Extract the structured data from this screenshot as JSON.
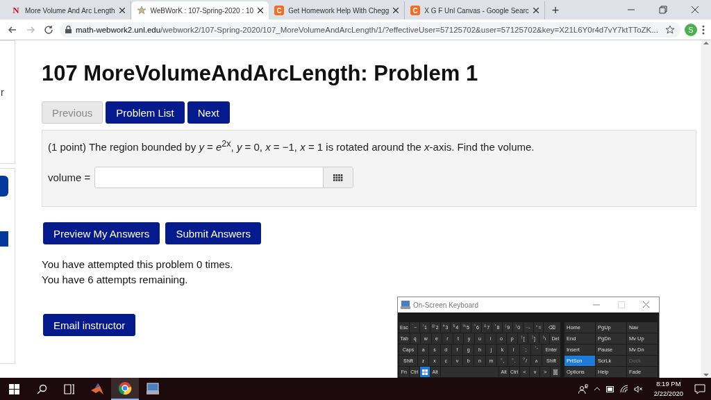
{
  "browser": {
    "tabs": [
      {
        "title": "More Volume And Arc Length",
        "icon_text": "N",
        "kind": "red-letter",
        "selected": false
      },
      {
        "title": "WeBWorK : 107-Spring-2020 : 10",
        "kind": "star",
        "selected": true
      },
      {
        "title": "Get Homework Help With Chegg",
        "icon_text": "C",
        "kind": "orange-letter",
        "selected": false
      },
      {
        "title": "X G F Unl Canvas - Google Searc",
        "icon_text": "C",
        "kind": "orange-letter",
        "selected": false
      }
    ],
    "new_tab": "+",
    "url_host": "math-webwork2.unl.edu",
    "url_path": "/webwork2/107-Spring-2020/107_MoreVolumeAndArcLength/1/?effectiveUser=57125702&user=57125702&key=X21L6Y0r4d7vY7ktTToZK...",
    "profile": "S"
  },
  "sidebar": {
    "text": "r"
  },
  "page": {
    "title": "107 MoreVolumeAndArcLength: Problem 1",
    "nav": [
      {
        "label": "Previous",
        "disabled": true
      },
      {
        "label": "Problem List",
        "disabled": false
      },
      {
        "label": "Next",
        "disabled": false
      }
    ],
    "problem": {
      "text": "(1 point) The region bounded by *y* = *e*$^{2x}$, *y* = 0, *x* = −1, *x* = 1 is rotated around the *x*-axis. Find the volume.",
      "answer_label": "volume ="
    },
    "actions": [
      "Preview My Answers",
      "Submit Answers"
    ],
    "messages": [
      "You have attempted this problem 0 times.",
      "You have 6 attempts remaining."
    ],
    "email": "Email instructor"
  },
  "osk": {
    "title": "On-Screen Keyboard",
    "rows": [
      [
        {
          "label": "Esc",
          "kind": "key"
        },
        {
          "label": "~",
          "top": "`",
          "kind": "key"
        },
        {
          "label": "1",
          "top": "!",
          "kind": "key"
        },
        {
          "label": "2",
          "top": "@",
          "kind": "key"
        },
        {
          "label": "3",
          "top": "#",
          "kind": "key"
        },
        {
          "label": "4",
          "top": "$",
          "kind": "key"
        },
        {
          "label": "5",
          "top": "%",
          "kind": "key"
        },
        {
          "label": "6",
          "top": "^",
          "kind": "key"
        },
        {
          "label": "7",
          "top": "&",
          "kind": "key"
        },
        {
          "label": "8",
          "top": "*",
          "kind": "key"
        },
        {
          "label": "9",
          "top": "(",
          "kind": "key"
        },
        {
          "label": "0",
          "top": ")",
          "kind": "key"
        },
        {
          "label": "-",
          "top": "_",
          "kind": "key"
        },
        {
          "label": "=",
          "top": "+",
          "kind": "key"
        },
        {
          "label": "⌫",
          "kind": "wide"
        }
      ],
      [
        {
          "label": "Tab",
          "kind": "key"
        },
        {
          "label": "q",
          "kind": "key"
        },
        {
          "label": "w",
          "kind": "key"
        },
        {
          "label": "e",
          "kind": "key"
        },
        {
          "label": "r",
          "kind": "key"
        },
        {
          "label": "t",
          "kind": "key"
        },
        {
          "label": "y",
          "kind": "key"
        },
        {
          "label": "u",
          "kind": "key"
        },
        {
          "label": "i",
          "kind": "key"
        },
        {
          "label": "o",
          "kind": "key"
        },
        {
          "label": "p",
          "kind": "key"
        },
        {
          "label": "[",
          "top": "{",
          "kind": "key"
        },
        {
          "label": "]",
          "top": "}",
          "kind": "key"
        },
        {
          "label": "\\",
          "top": "|",
          "kind": "key"
        },
        {
          "label": "Del",
          "kind": "key"
        }
      ],
      [
        {
          "label": "Caps",
          "kind": "wide"
        },
        {
          "label": "a",
          "kind": "key"
        },
        {
          "label": "s",
          "kind": "key"
        },
        {
          "label": "d",
          "kind": "key"
        },
        {
          "label": "f",
          "kind": "key"
        },
        {
          "label": "g",
          "kind": "key"
        },
        {
          "label": "h",
          "kind": "key"
        },
        {
          "label": "j",
          "kind": "key"
        },
        {
          "label": "k",
          "kind": "key"
        },
        {
          "label": "l",
          "kind": "key"
        },
        {
          "label": ";",
          "top": ":",
          "kind": "key"
        },
        {
          "label": "'",
          "top": "\"",
          "kind": "key"
        },
        {
          "label": "Enter",
          "kind": "wide"
        }
      ],
      [
        {
          "label": "Shift",
          "kind": "wide"
        },
        {
          "label": "z",
          "kind": "key"
        },
        {
          "label": "x",
          "kind": "key"
        },
        {
          "label": "c",
          "kind": "key"
        },
        {
          "label": "v",
          "kind": "key"
        },
        {
          "label": "b",
          "kind": "key"
        },
        {
          "label": "n",
          "kind": "key"
        },
        {
          "label": "m",
          "kind": "key"
        },
        {
          "label": ",",
          "top": "<",
          "kind": "key"
        },
        {
          "label": ".",
          "top": ">",
          "kind": "key"
        },
        {
          "label": "/",
          "top": "?",
          "kind": "key"
        },
        {
          "label": "∧",
          "kind": "key"
        },
        {
          "label": "Shift",
          "kind": "wide"
        }
      ],
      [
        {
          "label": "Fn",
          "kind": "key"
        },
        {
          "label": "Ctrl",
          "kind": "key"
        },
        {
          "kind": "windows"
        },
        {
          "label": "Alt",
          "kind": "key"
        },
        {
          "kind": "space"
        },
        {
          "label": "Alt",
          "kind": "key"
        },
        {
          "label": "Ctrl",
          "kind": "key"
        },
        {
          "label": "<",
          "kind": "key"
        },
        {
          "label": "∨",
          "kind": "key"
        },
        {
          "label": ">",
          "kind": "key"
        },
        {
          "kind": "menu"
        }
      ]
    ],
    "side": [
      [
        {
          "label": "Home",
          "kind": "key"
        },
        {
          "label": "PgUp",
          "kind": "key"
        },
        {
          "label": "Nav",
          "kind": "key"
        }
      ],
      [
        {
          "label": "End",
          "kind": "key"
        },
        {
          "label": "PgDn",
          "kind": "key"
        },
        {
          "label": "Mv Up",
          "kind": "key"
        }
      ],
      [
        {
          "label": "Insert",
          "kind": "key"
        },
        {
          "label": "Pause",
          "kind": "key"
        },
        {
          "label": "Mv Dn",
          "kind": "key"
        }
      ],
      [
        {
          "label": "PrtScn",
          "kind": "highlight"
        },
        {
          "label": "ScrLk",
          "kind": "key"
        },
        {
          "label": "Dock",
          "kind": "disabled"
        }
      ],
      [
        {
          "label": "Options",
          "kind": "key"
        },
        {
          "label": "Help",
          "kind": "key"
        },
        {
          "label": "Fade",
          "kind": "key"
        }
      ]
    ]
  },
  "taskbar": {
    "apps": [
      {
        "kind": "matlab",
        "selected": false
      },
      {
        "kind": "chrome",
        "selected": true
      },
      {
        "kind": "keyboard-app",
        "selected": false
      }
    ],
    "time": "8:19 PM",
    "date": "2/22/2020"
  }
}
